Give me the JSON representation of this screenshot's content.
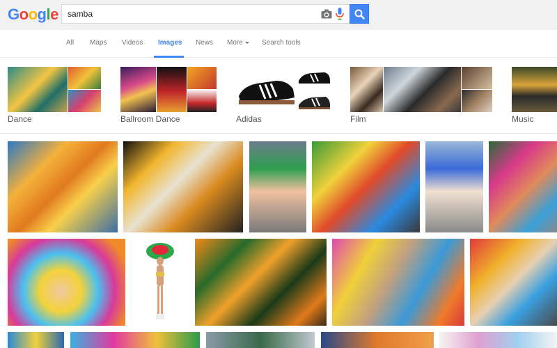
{
  "logo": {
    "letters": [
      "G",
      "o",
      "o",
      "g",
      "l",
      "e"
    ]
  },
  "search": {
    "query": "samba"
  },
  "tabs": [
    {
      "label": "All"
    },
    {
      "label": "Maps"
    },
    {
      "label": "Videos"
    },
    {
      "label": "Images"
    },
    {
      "label": "News"
    },
    {
      "label": "More"
    },
    {
      "label": "Search tools"
    }
  ],
  "active_tab": "Images",
  "categories": [
    {
      "label": "Dance"
    },
    {
      "label": "Ballroom Dance"
    },
    {
      "label": "Adidas"
    },
    {
      "label": "Film"
    },
    {
      "label": "Music"
    }
  ],
  "colors": {
    "brand_blue": "#4285f4",
    "header_bg": "#f1f1f1",
    "tab_text": "#777777"
  },
  "icons": [
    "camera-icon",
    "mic-icon",
    "search-icon",
    "chevron-down-icon"
  ]
}
